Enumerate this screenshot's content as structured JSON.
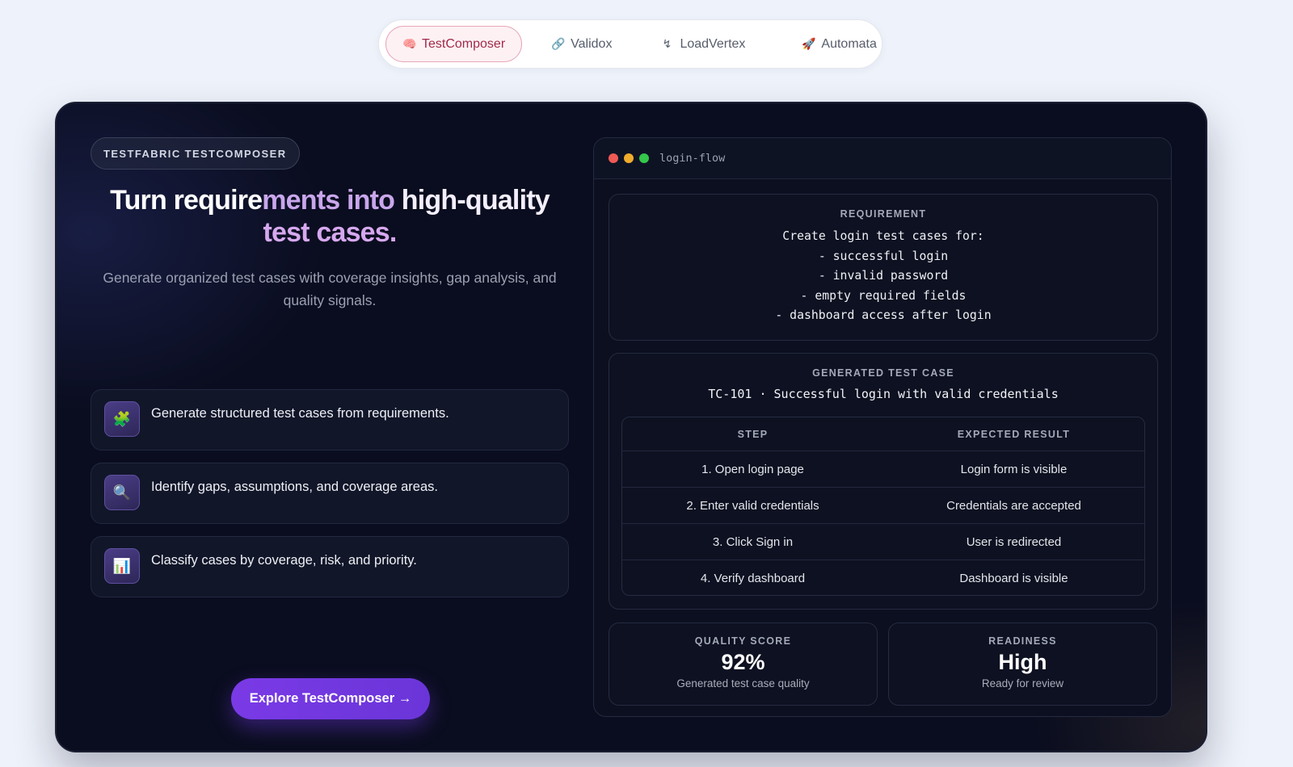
{
  "tabs": [
    {
      "icon": "🧠",
      "icon_name": "brain-icon",
      "label": "TestComposer",
      "active": true
    },
    {
      "icon": "🔗",
      "icon_name": "link-icon",
      "label": "Validox",
      "active": false
    },
    {
      "icon": "↯",
      "icon_name": "lightning-icon",
      "label": "LoadVertex",
      "active": false
    },
    {
      "icon": "🚀",
      "icon_name": "rocket-icon",
      "label": "Automata",
      "active": false
    }
  ],
  "hero": {
    "badge": "TESTFABRIC TESTCOMPOSER",
    "headline": {
      "part1": "Turn require",
      "part2": "ments into",
      "part3": " high-quality",
      "part4": "test cases."
    },
    "subtitle": "Generate organized test cases with coverage insights, gap analysis, and quality signals.",
    "features": [
      {
        "icon": "🧩",
        "icon_name": "puzzle-icon",
        "text": "Generate structured test cases from requirements."
      },
      {
        "icon": "🔍",
        "icon_name": "magnifier-icon",
        "text": "Identify gaps, assumptions, and coverage areas."
      },
      {
        "icon": "📊",
        "icon_name": "bar-chart-icon",
        "text": "Classify cases by coverage, risk, and priority."
      }
    ],
    "cta": "Explore TestComposer →"
  },
  "panel": {
    "filename": "login-flow",
    "requirement": {
      "label": "REQUIREMENT",
      "lines": [
        "Create login test cases for:",
        "- successful login",
        "- invalid password",
        "- empty required fields",
        "- dashboard access after login"
      ]
    },
    "generated": {
      "label": "GENERATED TEST CASE",
      "title": "TC-101 · Successful login with valid credentials",
      "columns": [
        "STEP",
        "EXPECTED RESULT"
      ],
      "rows": [
        [
          "1. Open login page",
          "Login form is visible"
        ],
        [
          "2. Enter valid credentials",
          "Credentials are accepted"
        ],
        [
          "3. Click Sign in",
          "User is redirected"
        ],
        [
          "4. Verify dashboard",
          "Dashboard is visible"
        ]
      ]
    },
    "quality": {
      "label": "QUALITY SCORE",
      "value": "92%",
      "sub": "Generated test case quality"
    },
    "readiness": {
      "label": "READINESS",
      "value": "High",
      "sub": "Ready for review"
    }
  },
  "colors": {
    "accent": "#7a3ae6",
    "active_tab_text": "#a12a4a",
    "card_bg": "#0a0d1f",
    "headline_highlight": "#c9a6ec"
  }
}
